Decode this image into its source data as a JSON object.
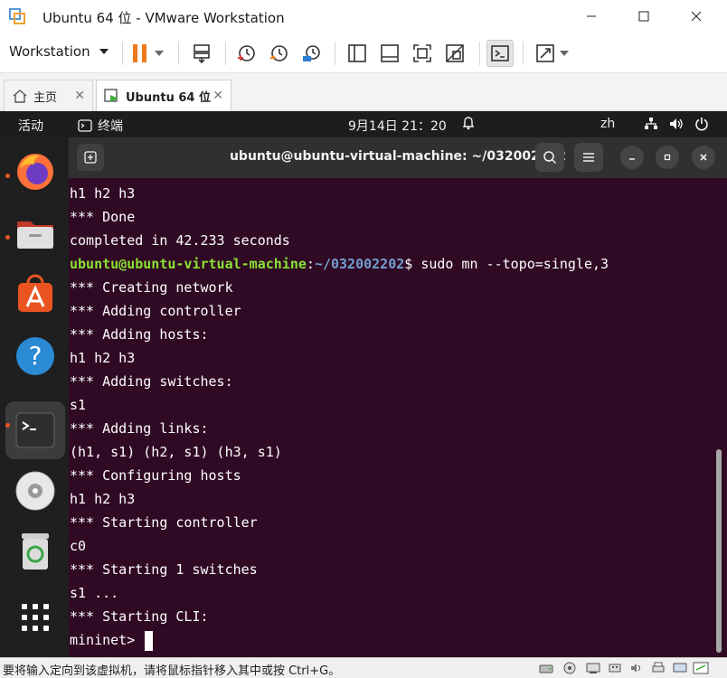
{
  "window": {
    "title": "Ubuntu 64 位 - VMware Workstation",
    "minimize_glyph": "—",
    "maximize_glyph": "☐",
    "close_glyph": "✕"
  },
  "toolbar": {
    "menu_label": "Workstation",
    "icons": [
      "pause-icon",
      "send-keys-icon",
      "snapshot-take-icon",
      "snapshot-revert-icon",
      "snapshot-manager-icon",
      "sidebar-icon",
      "console-view-icon",
      "fullscreen-icon",
      "unity-icon",
      "terminal-console-icon",
      "stretch-icon"
    ]
  },
  "tabs": [
    {
      "label": "主页",
      "icon": "home-icon",
      "active": false
    },
    {
      "label": "Ubuntu 64 位",
      "icon": "vm-icon",
      "active": true
    }
  ],
  "gnome": {
    "activities": "活动",
    "app_name": "终端",
    "clock": "9月14日  21：20",
    "input_method": "zh"
  },
  "dock": {
    "items": [
      {
        "name": "firefox-icon",
        "running": true
      },
      {
        "name": "files-icon",
        "running": true
      },
      {
        "name": "app-center-icon",
        "running": false
      },
      {
        "name": "help-icon",
        "running": false
      },
      {
        "name": "terminal-icon",
        "running": true
      },
      {
        "name": "cd-drive-icon",
        "running": false
      },
      {
        "name": "trash-icon",
        "running": false
      },
      {
        "name": "show-apps-icon",
        "running": false
      }
    ]
  },
  "terminal": {
    "title": "ubuntu@ubuntu-virtual-machine: ~/032002202",
    "lines": [
      "h1 h2 h3",
      "*** Done",
      "completed in 42.233 seconds",
      "",
      "*** Creating network",
      "*** Adding controller",
      "*** Adding hosts:",
      "h1 h2 h3",
      "*** Adding switches:",
      "s1",
      "*** Adding links:",
      "(h1, s1) (h2, s1) (h3, s1)",
      "*** Configuring hosts",
      "h1 h2 h3",
      "*** Starting controller",
      "c0",
      "*** Starting 1 switches",
      "s1 ...",
      "*** Starting CLI:",
      ""
    ],
    "prompt_user": "ubuntu@ubuntu-virtual-machine",
    "prompt_colon": ":",
    "prompt_path": "~/032002202",
    "prompt_symbol": "$",
    "prompt_command": " sudo mn --topo=single,3",
    "mininet_prompt": "mininet> "
  },
  "statusbar": {
    "text": "要将输入定向到该虚拟机，请将鼠标指针移入其中或按 Ctrl+G。"
  }
}
